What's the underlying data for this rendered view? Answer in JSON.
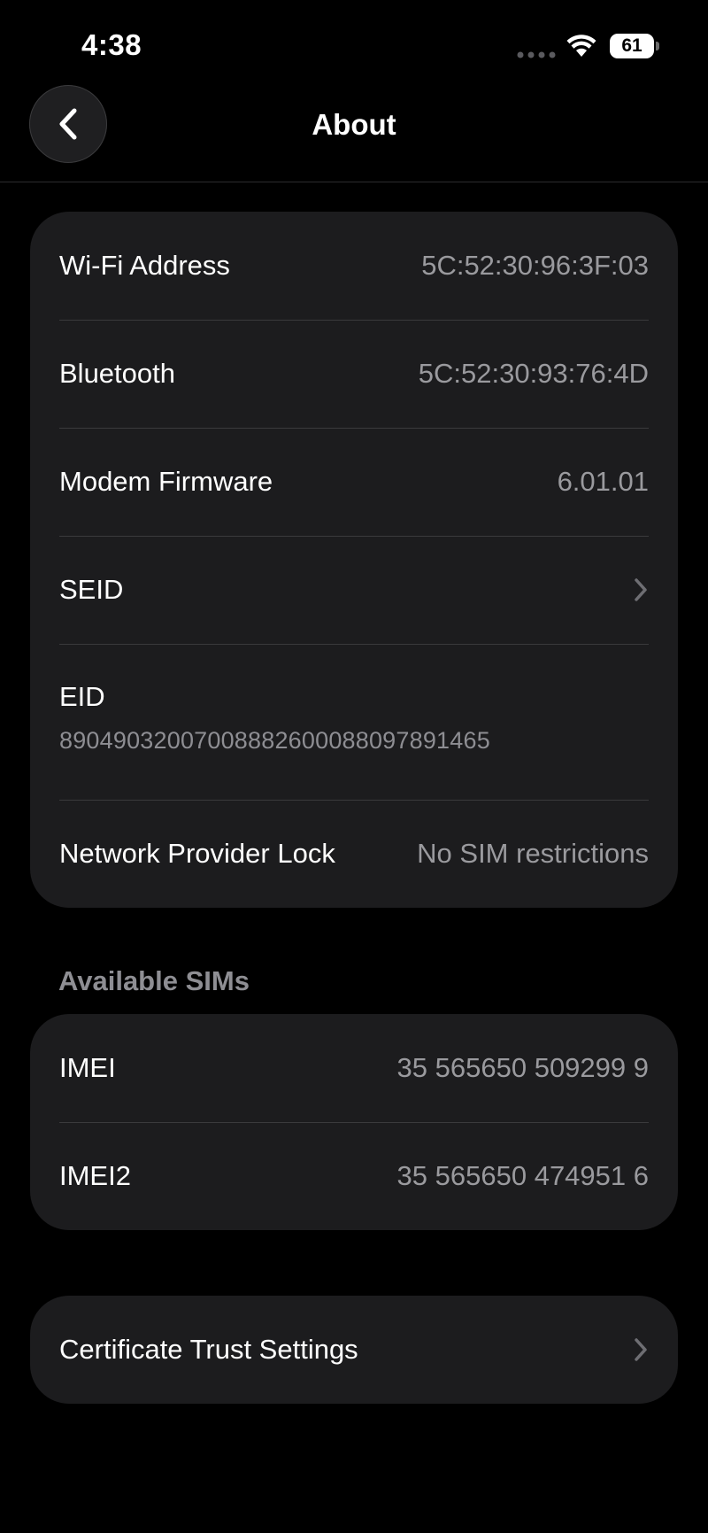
{
  "status_bar": {
    "time": "4:38",
    "battery_level": "61"
  },
  "nav": {
    "title": "About",
    "back_icon": "chevron-left-icon"
  },
  "about_group": {
    "rows": [
      {
        "label": "Wi-Fi Address",
        "value": "5C:52:30:96:3F:03"
      },
      {
        "label": "Bluetooth",
        "value": "5C:52:30:93:76:4D"
      },
      {
        "label": "Modem Firmware",
        "value": "6.01.01"
      },
      {
        "label": "SEID"
      },
      {
        "label": "EID",
        "value": "89049032007008882600088097891465"
      },
      {
        "label": "Network Provider Lock",
        "value": "No SIM restrictions"
      }
    ]
  },
  "sims_section": {
    "header": "Available SIMs",
    "rows": [
      {
        "label": "IMEI",
        "value": "35 565650 509299 9"
      },
      {
        "label": "IMEI2",
        "value": "35 565650 474951 6"
      }
    ]
  },
  "certificate_group": {
    "label": "Certificate Trust Settings"
  },
  "colors": {
    "background": "#000000",
    "card": "#1c1c1e",
    "separator": "#3a3a3c",
    "secondary_text": "#9a9a9e"
  }
}
